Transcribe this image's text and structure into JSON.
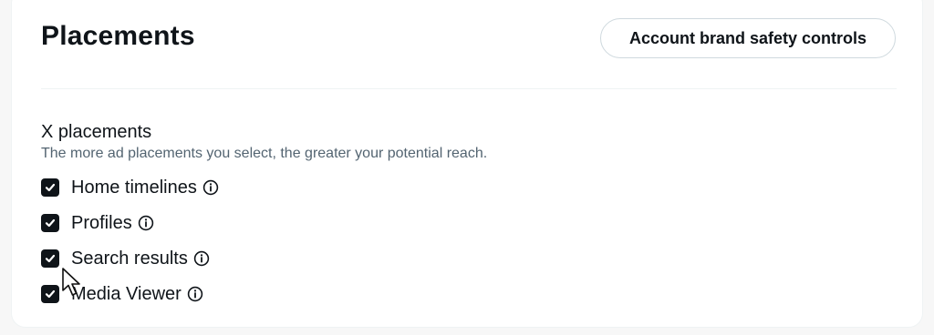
{
  "header": {
    "title": "Placements",
    "brand_safety_button": "Account brand safety controls"
  },
  "x_placements": {
    "heading": "X placements",
    "description": "The more ad placements you select, the greater your potential reach.",
    "options": [
      {
        "label": "Home timelines",
        "checked": true,
        "icon": "info-icon"
      },
      {
        "label": "Profiles",
        "checked": true,
        "icon": "info-icon"
      },
      {
        "label": "Search results",
        "checked": true,
        "icon": "info-icon"
      },
      {
        "label": "Media Viewer",
        "checked": true,
        "icon": "info-icon"
      }
    ]
  },
  "colors": {
    "text_primary": "#0f1419",
    "text_secondary": "#536471",
    "checkbox_fill": "#0f1419",
    "border": "#cfd9de"
  }
}
